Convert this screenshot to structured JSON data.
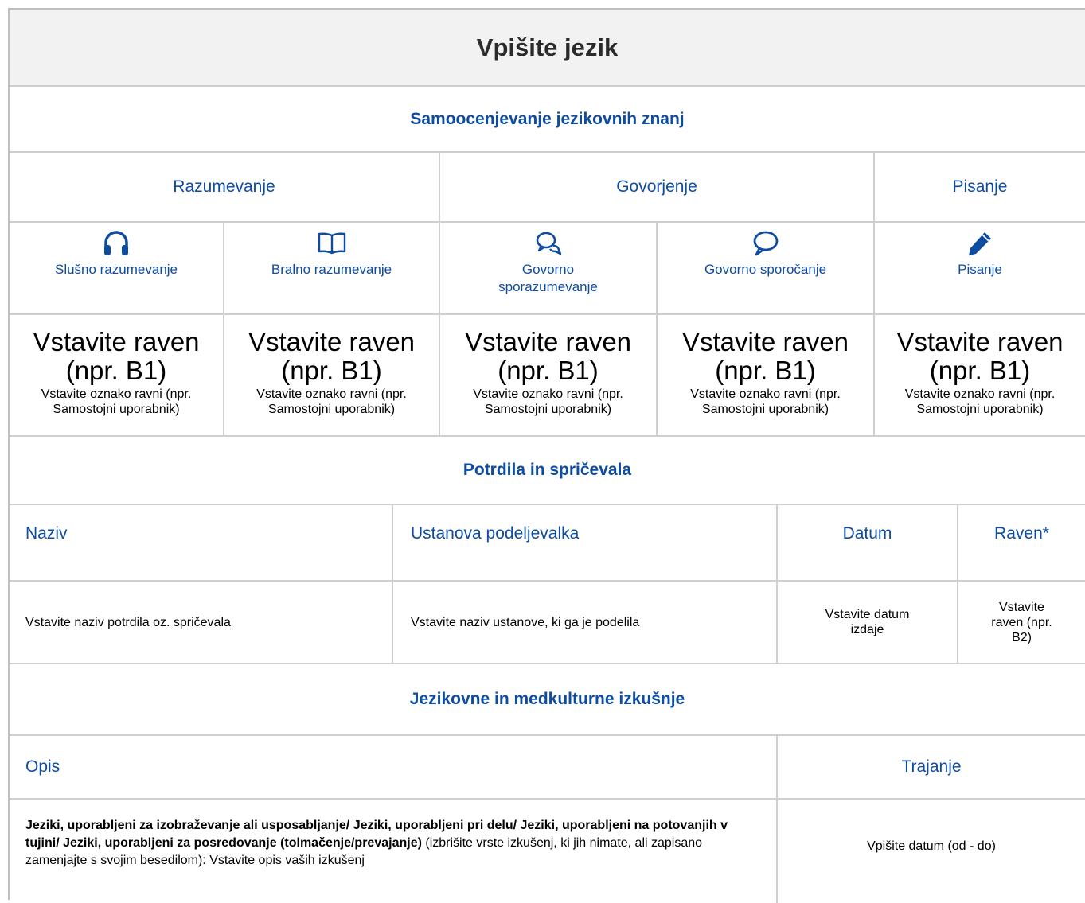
{
  "title": "Vpišite jezik",
  "self_assessment": {
    "heading": "Samoocenjevanje jezikovnih znanj",
    "groups": [
      "Razumevanje",
      "Govorjenje",
      "Pisanje"
    ],
    "skills": [
      {
        "label": "Slušno razumevanje",
        "icon": "headphones-icon"
      },
      {
        "label": "Bralno razumevanje",
        "icon": "book-icon"
      },
      {
        "label": "Govorno sporazumevanje",
        "icon": "chat-bubbles-icon"
      },
      {
        "label": "Govorno sporočanje",
        "icon": "speech-bubble-icon"
      },
      {
        "label": "Pisanje",
        "icon": "pencil-icon"
      }
    ],
    "level_big": "Vstavite raven (npr. B1)",
    "level_small": "Vstavite oznako ravni (npr. Samostojni uporabnik)"
  },
  "certificates": {
    "heading": "Potrdila in spričevala",
    "columns": [
      "Naziv",
      "Ustanova podeljevalka",
      "Datum",
      "Raven*"
    ],
    "row": [
      "Vstavite naziv potrdila oz. spričevala",
      "Vstavite naziv ustanove, ki ga je podelila",
      "Vstavite datum izdaje",
      "Vstavite raven (npr. B2)"
    ]
  },
  "experience": {
    "heading": "Jezikovne in medkulturne izkušnje",
    "columns": [
      "Opis",
      "Trajanje"
    ],
    "description_bold": "Jeziki, uporabljeni za izobraževanje ali usposabljanje/ Jeziki, uporabljeni pri delu/ Jeziki, uporabljeni na potovanjih v tujini/ Jeziki, uporabljeni za posredovanje (tolmačenje/prevajanje)",
    "description_rest": " (izbrišite vrste izkušenj, ki jih nimate, ali zapisano zamenjajte s svojim besedilom): Vstavite opis vaših izkušenj",
    "duration": "Vpišite datum (od - do)"
  },
  "colors": {
    "accent": "#0e4ca1",
    "title_bg": "#f2f2f2",
    "border": "#cfcfcf"
  }
}
